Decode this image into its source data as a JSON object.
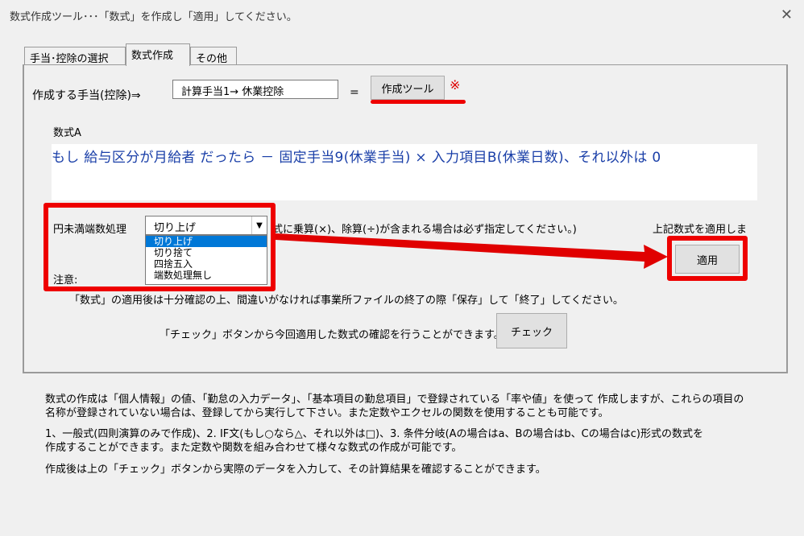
{
  "window": {
    "title": "数式作成ツール･･･「数式」を作成し「適用」してください。",
    "close_glyph": "✕"
  },
  "tabs": [
    {
      "label": "手当･控除の選択"
    },
    {
      "label": "数式作成"
    },
    {
      "label": "その他"
    }
  ],
  "form": {
    "target_label": "作成する手当(控除)⇒",
    "target_value": "計算手当1→ 休業控除",
    "equals": "=",
    "create_tool_button": "作成ツール",
    "create_tool_mark": "※",
    "formula_label": "数式A",
    "formula_text": "もし 給与区分が月給者 だったら － 固定手当9(休業手当) × 入力項目B(休業日数)、それ以外は 0",
    "rounding_label": "円未満端数処理",
    "rounding_selected": "切り上げ",
    "rounding_options": [
      "切り上げ",
      "切り捨て",
      "四捨五入",
      "端数処理無し"
    ],
    "rounding_note": "式に乗算(×)、除算(÷)が含まれる場合は必ず指定してください。)",
    "apply_note": "上記数式を適用しま",
    "apply_button": "適用",
    "caution_label": "注意:",
    "caution_text": "「数式」の適用後は十分確認の上、間違いがなければ事業所ファイルの終了の際「保存」して「終了」してください。",
    "check_text": "「チェック」ボタンから今回適用した数式の確認を行うことができます。⇒",
    "check_button": "チェック"
  },
  "help": {
    "para1_line1": "数式の作成は「個人情報」の値、「勤怠の入力データ」、「基本項目の勤怠項目」で登録されている「率や値」を使って 作成しますが、これらの項目の",
    "para1_line2": "名称が登録されていない場合は、登録してから実行して下さい。また定数やエクセルの関数を使用することも可能です。",
    "para2_line1": "1、一般式(四則演算のみで作成)、2. IF文(もし○なら△、それ以外は□)、3. 条件分岐(Aの場合はa、Bの場合はb、Cの場合はc)形式の数式を",
    "para2_line2": "作成することができます。また定数や関数を組み合わせて様々な数式の作成が可能です。",
    "para3": "作成後は上の「チェック」ボタンから実際のデータを入力して、その計算結果を確認することができます。"
  },
  "colors": {
    "highlight_red": "#e00000",
    "formula_blue": "#1a3fa8",
    "selection_blue": "#0078d7"
  }
}
